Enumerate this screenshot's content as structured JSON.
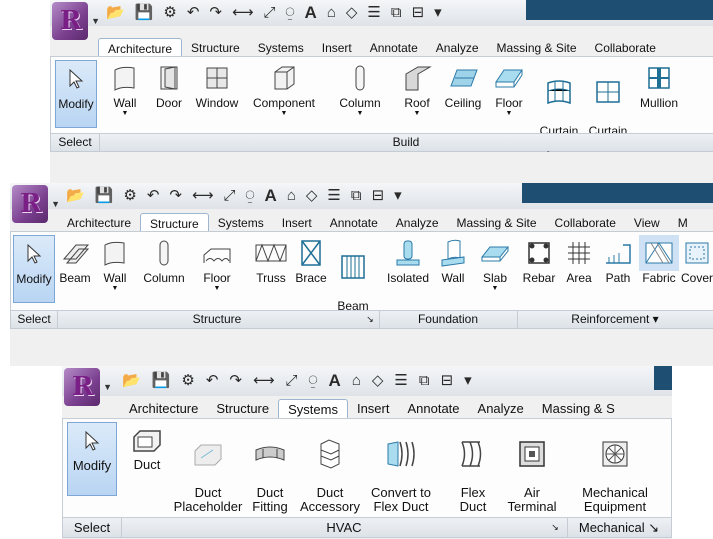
{
  "ribbon1": {
    "tabs": [
      "Architecture",
      "Structure",
      "Systems",
      "Insert",
      "Annotate",
      "Analyze",
      "Massing & Site",
      "Collaborate"
    ],
    "active_tab": "Architecture",
    "buttons": [
      {
        "label": "Modify",
        "icon": "pointer-icon"
      },
      {
        "label": "Wall",
        "icon": "wall-icon",
        "dropdown": true
      },
      {
        "label": "Door",
        "icon": "door-icon"
      },
      {
        "label": "Window",
        "icon": "window-icon"
      },
      {
        "label": "Component",
        "icon": "component-icon",
        "dropdown": true
      },
      {
        "label": "Column",
        "icon": "column-icon",
        "dropdown": true
      },
      {
        "label": "Roof",
        "icon": "roof-icon",
        "dropdown": true
      },
      {
        "label": "Ceiling",
        "icon": "ceiling-icon"
      },
      {
        "label": "Floor",
        "icon": "floor-icon",
        "dropdown": true
      },
      {
        "label": "Curtain\nSystem",
        "icon": "curtain-system-icon"
      },
      {
        "label": "Curtain\nGrid",
        "icon": "curtain-grid-icon"
      },
      {
        "label": "Mullion",
        "icon": "mullion-icon"
      }
    ],
    "panels": [
      "Select",
      "Build"
    ]
  },
  "ribbon2": {
    "tabs": [
      "Architecture",
      "Structure",
      "Systems",
      "Insert",
      "Annotate",
      "Analyze",
      "Massing & Site",
      "Collaborate",
      "View",
      "M"
    ],
    "active_tab": "Structure",
    "buttons": [
      {
        "label": "Modify",
        "icon": "pointer-icon"
      },
      {
        "label": "Beam",
        "icon": "beam-icon"
      },
      {
        "label": "Wall",
        "icon": "wall-icon",
        "dropdown": true
      },
      {
        "label": "Column",
        "icon": "column-icon"
      },
      {
        "label": "Floor",
        "icon": "floor-icon",
        "dropdown": true
      },
      {
        "label": "Truss",
        "icon": "truss-icon"
      },
      {
        "label": "Brace",
        "icon": "brace-icon"
      },
      {
        "label": "Beam\nSystem",
        "icon": "beam-system-icon"
      },
      {
        "label": "Isolated",
        "icon": "isolated-footing-icon"
      },
      {
        "label": "Wall",
        "icon": "wall-footing-icon"
      },
      {
        "label": "Slab",
        "icon": "slab-icon",
        "dropdown": true
      },
      {
        "label": "Rebar",
        "icon": "rebar-icon"
      },
      {
        "label": "Area",
        "icon": "area-icon"
      },
      {
        "label": "Path",
        "icon": "path-icon"
      },
      {
        "label": "Fabric",
        "icon": "fabric-icon"
      },
      {
        "label": "Cover",
        "icon": "cover-icon"
      }
    ],
    "panels": [
      "Select",
      "Structure",
      "Foundation",
      "Reinforcement ▾"
    ],
    "panel_launcher": "↘"
  },
  "ribbon3": {
    "tabs": [
      "Architecture",
      "Structure",
      "Systems",
      "Insert",
      "Annotate",
      "Analyze",
      "Massing & S"
    ],
    "active_tab": "Systems",
    "buttons": [
      {
        "label": "Modify",
        "icon": "pointer-icon"
      },
      {
        "label": "Duct",
        "icon": "duct-icon"
      },
      {
        "label": "Duct\nPlaceholder",
        "icon": "duct-placeholder-icon"
      },
      {
        "label": "Duct\nFitting",
        "icon": "duct-fitting-icon"
      },
      {
        "label": "Duct\nAccessory",
        "icon": "duct-accessory-icon"
      },
      {
        "label": "Convert to\nFlex Duct",
        "icon": "convert-flex-duct-icon"
      },
      {
        "label": "Flex\nDuct",
        "icon": "flex-duct-icon"
      },
      {
        "label": "Air\nTerminal",
        "icon": "air-terminal-icon"
      },
      {
        "label": "Mechanical\nEquipment",
        "icon": "mechanical-equipment-icon"
      }
    ],
    "panels": [
      "Select",
      "HVAC",
      "Mechanical ↘"
    ],
    "panel_launcher": "↘"
  },
  "qat_icons": [
    "open-icon",
    "save-icon",
    "sync-icon",
    "undo-icon",
    "redo-icon",
    "measure-icon",
    "dimension-icon",
    "tag-icon",
    "text-icon",
    "3d-view-icon",
    "section-icon",
    "thin-lines-icon",
    "close-hidden-icon",
    "switch-windows-icon",
    "customize-icon"
  ],
  "text_icon_label": "A",
  "colors": {
    "accent": "#1e4f73",
    "selected": "#b9d5f3",
    "logo": "#7a1f86"
  }
}
